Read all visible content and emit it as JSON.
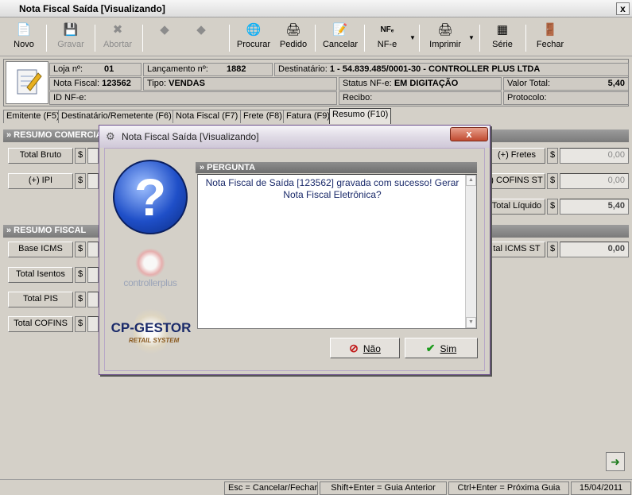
{
  "window": {
    "title": "Nota Fiscal Saída [Visualizando]",
    "close": "x"
  },
  "toolbar": {
    "novo": "Novo",
    "gravar": "Gravar",
    "abortar": "Abortar",
    "procurar": "Procurar",
    "pedido": "Pedido",
    "cancelar": "Cancelar",
    "nfe": "NF-e",
    "nfe_icon_text": "NFₑ",
    "imprimir": "Imprimir",
    "serie": "Série",
    "fechar": "Fechar"
  },
  "header": {
    "loja_label": "Loja nº:",
    "loja": "01",
    "lanc_label": "Lançamento nº:",
    "lanc": "1882",
    "dest_label": "Destinatário:",
    "dest": "1 - 54.839.485/0001-30 - CONTROLLER PLUS  LTDA",
    "nf_label": "Nota Fiscal:",
    "nf": "123562",
    "tipo_label": "Tipo:",
    "tipo": "VENDAS",
    "status_label": "Status NF-e:",
    "status": "EM DIGITAÇÃO",
    "valor_label": "Valor Total:",
    "valor": "5,40",
    "id_label": "ID NF-e:",
    "recibo_label": "Recibo:",
    "protocolo_label": "Protocolo:"
  },
  "tabs": [
    "Emitente (F5)",
    "Destinatário/Remetente (F6)",
    "Nota Fiscal (F7)",
    "Frete (F8)",
    "Fatura (F9)",
    "Resumo (F10)"
  ],
  "resumo": {
    "comercial_hdr": "» RESUMO COMERCIA",
    "fiscal_hdr": "» RESUMO FISCAL",
    "total_bruto": "Total Bruto",
    "ipi": "(+) IPI",
    "fretes": "(+) Fretes",
    "fretes_val": "0,00",
    "cofins_st": ") COFINS ST",
    "cofins_st_val": "0,00",
    "total_liquido": "Total Líquido",
    "total_liquido_val": "5,40",
    "base_icms": "Base ICMS",
    "total_isentos": "Total Isentos",
    "total_pis": "Total PIS",
    "total_cofins": "Total COFINS",
    "total_icms_st": "tal ICMS ST",
    "total_icms_st_val": "0,00",
    "currency": "$"
  },
  "dialog": {
    "title": "Nota Fiscal Saída [Visualizando]",
    "close": "x",
    "qmark": "?",
    "brand1": "controllerplus",
    "brand2": "CP-GESTOR",
    "brand2_sub": "RETAIL SYSTEM",
    "pergunta": "» PERGUNTA",
    "message": "Nota Fiscal de Saída [123562] gravada com sucesso! Gerar Nota Fiscal Eletrônica?",
    "nao": "Não",
    "sim": "Sim"
  },
  "statusbar": {
    "esc": "Esc = Cancelar/Fechar",
    "shift": "Shift+Enter = Guia Anterior",
    "ctrl": "Ctrl+Enter = Próxima Guia",
    "date": "15/04/2011"
  }
}
